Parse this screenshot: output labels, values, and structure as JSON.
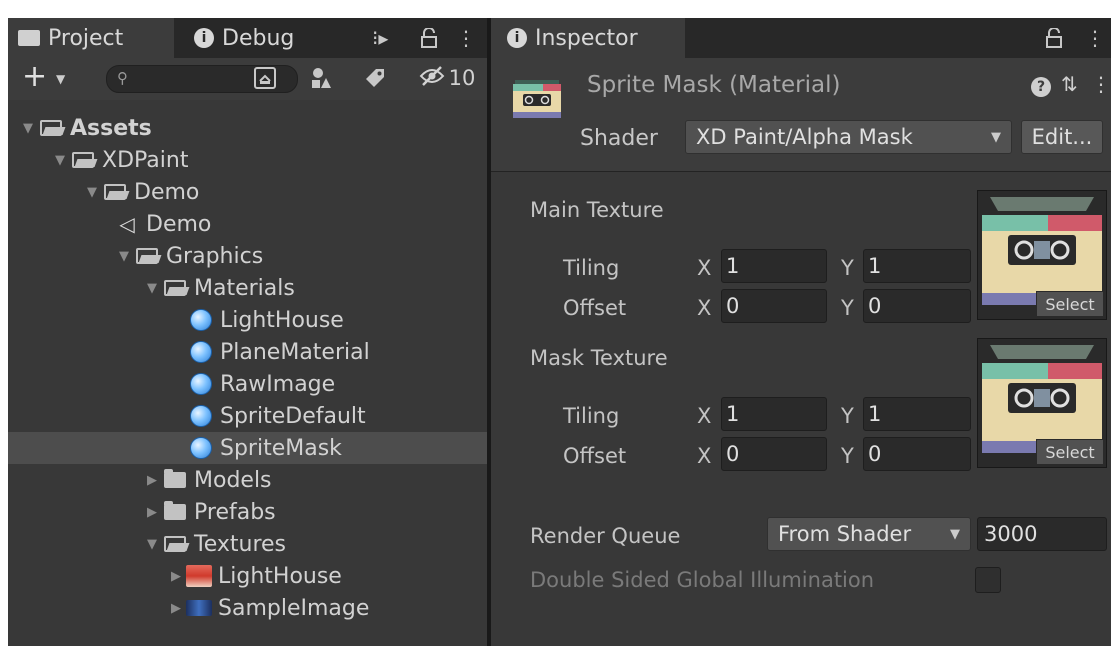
{
  "project_panel": {
    "tabs": [
      {
        "label": "Project",
        "icon": "folder-icon"
      },
      {
        "label": "Debug",
        "icon": "info-icon"
      }
    ],
    "toolbar": {
      "add_label": "+",
      "search_placeholder": "",
      "hidden_count": "10"
    },
    "tree": [
      {
        "label": "Assets",
        "depth": 0,
        "icon": "folder-open-icon",
        "expanded": true,
        "bold": true
      },
      {
        "label": "XDPaint",
        "depth": 1,
        "icon": "folder-open-icon",
        "expanded": true
      },
      {
        "label": "Demo",
        "depth": 2,
        "icon": "folder-open-icon",
        "expanded": true
      },
      {
        "label": "Demo",
        "depth": 3,
        "icon": "scene-icon"
      },
      {
        "label": "Graphics",
        "depth": 3,
        "icon": "folder-open-icon",
        "expanded": true
      },
      {
        "label": "Materials",
        "depth": 4,
        "icon": "folder-open-icon",
        "expanded": true
      },
      {
        "label": "LightHouse",
        "depth": 5,
        "icon": "material-icon"
      },
      {
        "label": "PlaneMaterial",
        "depth": 5,
        "icon": "material-icon"
      },
      {
        "label": "RawImage",
        "depth": 5,
        "icon": "material-icon"
      },
      {
        "label": "SpriteDefault",
        "depth": 5,
        "icon": "material-icon"
      },
      {
        "label": "SpriteMask",
        "depth": 5,
        "icon": "material-icon",
        "selected": true
      },
      {
        "label": "Models",
        "depth": 4,
        "icon": "folder-icon",
        "expanded": false
      },
      {
        "label": "Prefabs",
        "depth": 4,
        "icon": "folder-icon",
        "expanded": false
      },
      {
        "label": "Textures",
        "depth": 4,
        "icon": "folder-open-icon",
        "expanded": true
      },
      {
        "label": "LightHouse",
        "depth": 5,
        "icon": "texture-lighthouse-icon",
        "expanded": false
      },
      {
        "label": "SampleImage",
        "depth": 5,
        "icon": "texture-sampleimage-icon",
        "expanded": false
      }
    ]
  },
  "inspector": {
    "tab_label": "Inspector",
    "title": "Sprite Mask (Material)",
    "shader_label": "Shader",
    "shader_value": "XD Paint/Alpha Mask",
    "edit_label": "Edit...",
    "main_texture": {
      "label": "Main Texture",
      "tiling_label": "Tiling",
      "offset_label": "Offset",
      "tiling_x": "1",
      "tiling_y": "1",
      "offset_x": "0",
      "offset_y": "0",
      "select_label": "Select"
    },
    "mask_texture": {
      "label": "Mask Texture",
      "tiling_label": "Tiling",
      "offset_label": "Offset",
      "tiling_x": "1",
      "tiling_y": "1",
      "offset_x": "0",
      "offset_y": "0",
      "select_label": "Select"
    },
    "axis_x": "X",
    "axis_y": "Y",
    "render_queue_label": "Render Queue",
    "render_queue_mode": "From Shader",
    "render_queue_value": "3000",
    "double_sided_label": "Double Sided Global Illumination",
    "double_sided_checked": false
  },
  "colors": {
    "panel_bg": "#383838",
    "tab_bar_bg": "#282828",
    "selection_bg": "#4d4d4d",
    "field_bg": "#2a2a2a",
    "material_blue": "#7ec2ff"
  }
}
